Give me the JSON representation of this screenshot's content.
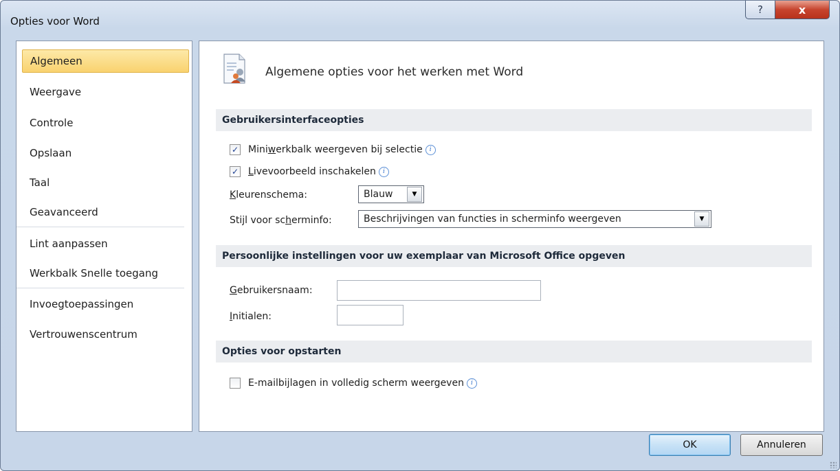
{
  "window": {
    "title": "Opties voor Word",
    "help_glyph": "?",
    "close_glyph": "x"
  },
  "sidebar": {
    "items": [
      {
        "label": "Algemeen",
        "active": true
      },
      {
        "label": "Weergave"
      },
      {
        "label": "Controle"
      },
      {
        "label": "Opslaan"
      },
      {
        "label": "Taal"
      },
      {
        "label": "Geavanceerd"
      },
      {
        "label": "Lint aanpassen"
      },
      {
        "label": "Werkbalk Snelle toegang"
      },
      {
        "label": "Invoegtoepassingen"
      },
      {
        "label": "Vertrouwenscentrum"
      }
    ]
  },
  "content": {
    "title": "Algemene opties voor het werken met Word",
    "sections": {
      "ui": {
        "header": "Gebruikersinterfaceopties",
        "minibar": {
          "pre": "Mini",
          "key": "w",
          "post": "erkbalk weergeven bij selectie",
          "checked": true
        },
        "live_preview": {
          "pre": "",
          "key": "L",
          "post": "ivevoorbeeld inschakelen",
          "checked": true
        },
        "color_scheme": {
          "label_key": "K",
          "label_rest": "leurenschema:",
          "value": "Blauw"
        },
        "screentip": {
          "label_pre": "Stijl voor sc",
          "label_key": "h",
          "label_post": "erminfo:",
          "value": "Beschrijvingen van functies in scherminfo weergeven"
        }
      },
      "personal": {
        "header": "Persoonlijke instellingen voor uw exemplaar van Microsoft Office opgeven",
        "username": {
          "label_key": "G",
          "label_rest": "ebruikersnaam:",
          "value": ""
        },
        "initials": {
          "label_key": "I",
          "label_rest": "nitialen:",
          "value": ""
        }
      },
      "startup": {
        "header": "Opties voor opstarten",
        "email_attach": {
          "pre": "E-mailbi",
          "key": "j",
          "post": "lagen in volledig scherm weergeven",
          "checked": false
        }
      }
    }
  },
  "buttons": {
    "ok": "OK",
    "cancel": "Annuleren"
  },
  "colors": {
    "active_nav": "#f9d26f",
    "section_bar": "#ebedf0",
    "close_button": "#c7442e"
  }
}
